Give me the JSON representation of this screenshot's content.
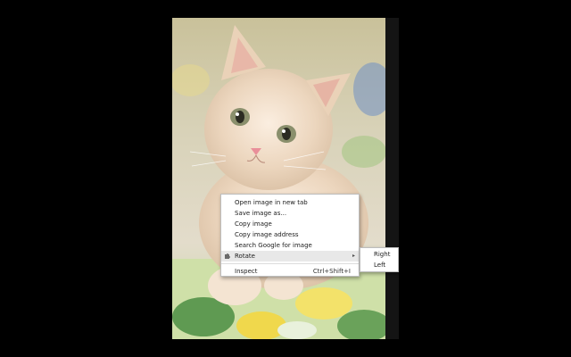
{
  "context_menu": {
    "items": [
      {
        "label": "Open image in new tab"
      },
      {
        "label": "Save image as..."
      },
      {
        "label": "Copy image"
      },
      {
        "label": "Copy image address"
      },
      {
        "label": "Search Google for image"
      },
      {
        "label": "Rotate",
        "icon": "puzzle-piece-icon",
        "has_submenu": true,
        "submenu_arrow": "▸"
      },
      {
        "label": "Inspect",
        "shortcut": "Ctrl+Shift+I"
      }
    ]
  },
  "rotate_submenu": {
    "items": [
      {
        "label": "Right"
      },
      {
        "label": "Left"
      }
    ]
  },
  "colors": {
    "page_background": "#000000",
    "menu_background": "#ffffff",
    "menu_highlight": "#e8e8e8"
  }
}
